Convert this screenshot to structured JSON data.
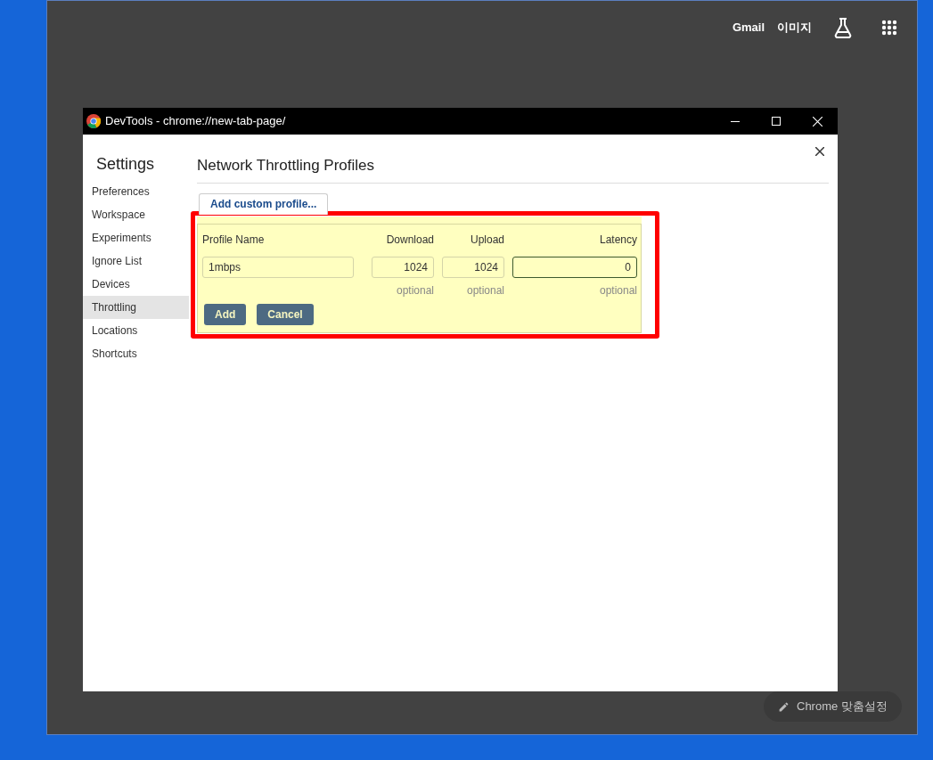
{
  "browser": {
    "header_links": [
      "Gmail",
      "이미지"
    ],
    "customize_button": "Chrome 맞춤설정"
  },
  "devtools_window": {
    "title": "DevTools - chrome://new-tab-page/",
    "sidebar": {
      "title": "Settings",
      "items": [
        {
          "label": "Preferences",
          "selected": false
        },
        {
          "label": "Workspace",
          "selected": false
        },
        {
          "label": "Experiments",
          "selected": false
        },
        {
          "label": "Ignore List",
          "selected": false
        },
        {
          "label": "Devices",
          "selected": false
        },
        {
          "label": "Throttling",
          "selected": true
        },
        {
          "label": "Locations",
          "selected": false
        },
        {
          "label": "Shortcuts",
          "selected": false
        }
      ]
    },
    "panel": {
      "title": "Network Throttling Profiles",
      "add_button": "Add custom profile...",
      "form": {
        "fields": [
          {
            "label": "Profile Name",
            "value": "1mbps",
            "kind": "text",
            "focused": false
          },
          {
            "label": "Download",
            "value": "1024",
            "kind": "number",
            "hint": "optional",
            "focused": false
          },
          {
            "label": "Upload",
            "value": "1024",
            "kind": "number",
            "hint": "optional",
            "focused": false
          },
          {
            "label": "Latency",
            "value": "0",
            "kind": "wide-number",
            "hint": "optional",
            "focused": true
          }
        ],
        "buttons": [
          "Add",
          "Cancel"
        ]
      }
    }
  }
}
